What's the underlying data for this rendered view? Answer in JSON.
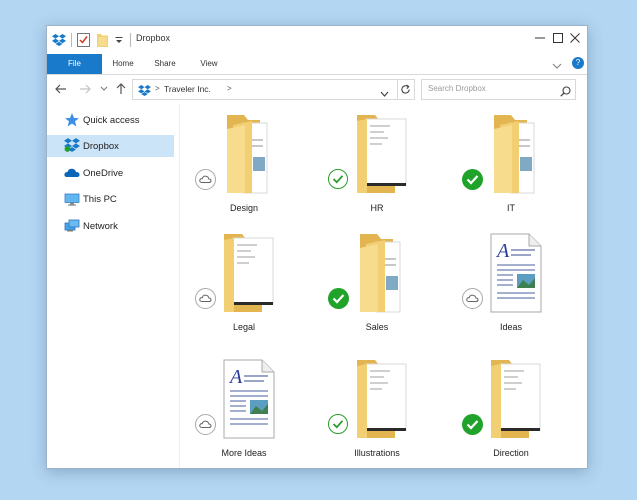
{
  "window": {
    "title": "Dropbox"
  },
  "ribbon": {
    "tabs": [
      "File",
      "Home",
      "Share",
      "View"
    ]
  },
  "address": {
    "path": "Traveler Inc.",
    "separator": ">"
  },
  "search": {
    "placeholder": "Search Dropbox"
  },
  "nav": {
    "items": [
      {
        "label": "Quick access",
        "icon": "star-icon"
      },
      {
        "label": "Dropbox",
        "icon": "dropbox-icon",
        "selected": true
      },
      {
        "label": "OneDrive",
        "icon": "cloud-icon"
      },
      {
        "label": "This PC",
        "icon": "computer-icon"
      },
      {
        "label": "Network",
        "icon": "network-icon"
      }
    ]
  },
  "files": [
    {
      "name": "Design",
      "kind": "folder-docs",
      "status": "online-only"
    },
    {
      "name": "HR",
      "kind": "folder-doc",
      "status": "synced"
    },
    {
      "name": "IT",
      "kind": "folder-docs",
      "status": "synced-always"
    },
    {
      "name": "Legal",
      "kind": "folder-doc",
      "status": "online-only"
    },
    {
      "name": "Sales",
      "kind": "folder-docs",
      "status": "synced-always"
    },
    {
      "name": "Ideas",
      "kind": "document",
      "status": "online-only"
    },
    {
      "name": "More Ideas",
      "kind": "document",
      "status": "online-only"
    },
    {
      "name": "Illustrations",
      "kind": "folder-doc",
      "status": "synced"
    },
    {
      "name": "Direction",
      "kind": "folder-doc",
      "status": "synced-always"
    }
  ],
  "colors": {
    "accent": "#1979ca",
    "synced_green": "#20a32a",
    "folder_yellow": "#f3cf74",
    "selection": "#cce4f7",
    "background": "#b3d6f2"
  }
}
